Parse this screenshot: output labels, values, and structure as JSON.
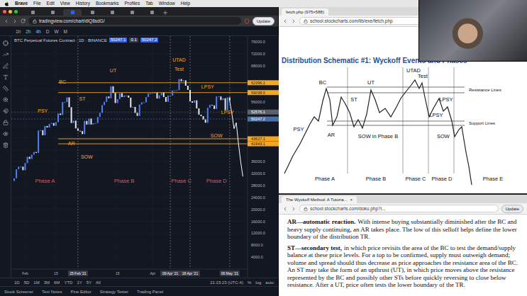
{
  "menubar": {
    "app": "Brave",
    "items": [
      "File",
      "Edit",
      "View",
      "History",
      "Bookmarks",
      "Profiles",
      "Tab",
      "Window",
      "Help"
    ]
  },
  "chart_window": {
    "tabs": [
      {
        "selected": false
      },
      {
        "selected": false
      },
      {
        "selected": true
      },
      {
        "selected": false
      },
      {
        "selected": false
      },
      {
        "selected": false
      },
      {
        "selected": false
      }
    ],
    "url": "tradingview.com/chart/dIQ8sdG/",
    "update": "Update",
    "intervals": [
      "1h",
      "2h",
      "4h",
      "D",
      "W",
      "M"
    ],
    "legend": {
      "title": "BTC Perpetual Futures Contract · 1D · BINANCE",
      "chips": [
        "50247.1",
        "0.1",
        "50247.2"
      ]
    },
    "price_ticks": [
      "76000.0",
      "72000.0",
      "68000.0",
      "64000.0",
      "60000.0",
      "56000.0",
      "52000.0",
      "48000.0",
      "44000.0",
      "40000.0",
      "36000.0",
      "32000.0",
      "28000.0",
      "24000.0",
      "20000.0",
      "16000.0",
      "12000.0",
      "8000.0",
      "4000.0"
    ],
    "date_ticks": [
      {
        "label": "Feb",
        "index": 5,
        "highlighted": false
      },
      {
        "label": "15",
        "index": 19,
        "highlighted": false
      },
      {
        "label": "25 Feb '21",
        "index": 29,
        "highlighted": true
      },
      {
        "label": "15",
        "index": 47,
        "highlighted": false
      },
      {
        "label": "Apr",
        "index": 63,
        "highlighted": false
      },
      {
        "label": "09 Apr '21",
        "index": 71,
        "highlighted": true
      },
      {
        "label": "18 Apr '21",
        "index": 80,
        "highlighted": true
      },
      {
        "label": "06 May '21",
        "index": 98,
        "highlighted": true
      }
    ],
    "series": [
      {
        "name": "BTCUSDT",
        "closes": [
          30400,
          33400,
          34300,
          34300,
          33100,
          35500,
          37600,
          36900,
          38300,
          39200,
          38900,
          46400,
          46500,
          44800,
          47900,
          47400,
          48600,
          48900,
          48000,
          49200,
          52100,
          51600,
          55900,
          55900,
          57500,
          54200,
          48900,
          49700,
          47100,
          46300,
          46200,
          45200,
          49600,
          48400,
          50400,
          48400,
          48800,
          48900,
          50900,
          52300,
          54900,
          56000,
          57800,
          57200,
          61200,
          59000,
          55600,
          56900,
          58900,
          57600,
          58100,
          58100,
          57400,
          54100,
          54300,
          52300,
          51300,
          55100,
          55800,
          55800,
          57600,
          58800,
          58800,
          59000,
          59100,
          57100,
          58200,
          59100,
          57600,
          56000,
          58100,
          58100,
          59800,
          59800,
          59900,
          63600,
          62900,
          63200,
          61400,
          60000,
          56200,
          55700,
          56500,
          53800,
          51700,
          51200,
          50100,
          49000,
          54000,
          55000,
          54800,
          53600,
          57800,
          57800,
          56600,
          57200,
          53200,
          57500,
          56400
        ]
      }
    ],
    "projection": {
      "start_index": 98,
      "values": [
        56400,
        52000,
        47000,
        49000,
        42000,
        36000,
        31000
      ]
    },
    "levels": [
      {
        "label": "62396.1",
        "value": 62396.1,
        "kind": "drawing",
        "color": "#f5a623"
      },
      {
        "label": "59098.0",
        "value": 59098.0,
        "kind": "drawing",
        "color": "#f5a623"
      },
      {
        "label": "52576.1",
        "value": 52576.1,
        "kind": "crosshair",
        "color": "#5d606b"
      },
      {
        "label": "50247.2",
        "value": 50247.2,
        "kind": "last",
        "color": "#4a6fa5"
      },
      {
        "label": "43627.1",
        "value": 43627.1,
        "kind": "drawing",
        "color": "#f5a623"
      },
      {
        "label": "41943.1",
        "value": 41943.1,
        "kind": "drawing",
        "color": "#f5a623"
      }
    ],
    "annotations": [
      {
        "text": "PSY",
        "kind": "event",
        "index": 13,
        "price": 52500
      },
      {
        "text": "BC",
        "kind": "event",
        "index": 22,
        "price": 62000
      },
      {
        "text": "ST",
        "kind": "event",
        "index": 31,
        "price": 56500
      },
      {
        "text": "AR",
        "kind": "event",
        "index": 26,
        "price": 41500
      },
      {
        "text": "SOW",
        "kind": "event",
        "index": 33,
        "price": 37000
      },
      {
        "text": "UT",
        "kind": "event",
        "index": 45,
        "price": 66000
      },
      {
        "text": "UTAD",
        "kind": "event",
        "index": 75,
        "price": 69500
      },
      {
        "text": "Test",
        "kind": "event",
        "index": 75,
        "price": 66500
      },
      {
        "text": "LPSY",
        "kind": "event",
        "index": 88,
        "price": 60500
      },
      {
        "text": "LPSY",
        "kind": "event",
        "index": 97,
        "price": 52000
      },
      {
        "text": "SOW",
        "kind": "event",
        "index": 92,
        "price": 44000
      },
      {
        "text": "Phase A",
        "kind": "phase",
        "index": 14,
        "price": 29000
      },
      {
        "text": "Phase B",
        "kind": "phase",
        "index": 50,
        "price": 29000
      },
      {
        "text": "Phase C",
        "kind": "phase",
        "index": 76,
        "price": 29000
      },
      {
        "text": "Phase D",
        "kind": "phase",
        "index": 92,
        "price": 29000
      }
    ],
    "ranges": [
      "1D",
      "5D",
      "1M",
      "3M",
      "6M",
      "YTD",
      "1Y",
      "5Y",
      "All"
    ],
    "time": "21:15:23 (UTC-4)",
    "scale_options": [
      "%",
      "log",
      "auto"
    ],
    "panels": [
      "Stock Screener",
      "Text Notes",
      "Pine Editor",
      "Strategy Tester",
      "Trading Panel"
    ]
  },
  "schematic_window": {
    "tab": "fetch.php (975×588)",
    "url": "school.stockcharts.com/lib/exe/fetch.php",
    "title": "Distribution Schematic #1: Wyckoff Events and Phases",
    "path": [
      [
        8,
        150
      ],
      [
        20,
        125
      ],
      [
        30,
        108
      ],
      [
        38,
        92
      ],
      [
        44,
        80
      ],
      [
        50,
        70
      ],
      [
        56,
        76
      ],
      [
        62,
        48
      ],
      [
        67,
        30
      ],
      [
        72,
        46
      ],
      [
        76,
        82
      ],
      [
        82,
        70
      ],
      [
        88,
        42
      ],
      [
        94,
        52
      ],
      [
        100,
        64
      ],
      [
        106,
        84
      ],
      [
        112,
        74
      ],
      [
        118,
        86
      ],
      [
        124,
        66
      ],
      [
        130,
        32
      ],
      [
        136,
        46
      ],
      [
        142,
        64
      ],
      [
        150,
        58
      ],
      [
        158,
        70
      ],
      [
        166,
        56
      ],
      [
        172,
        44
      ],
      [
        178,
        36
      ],
      [
        186,
        26
      ],
      [
        192,
        18
      ],
      [
        198,
        30
      ],
      [
        202,
        22
      ],
      [
        206,
        42
      ],
      [
        212,
        70
      ],
      [
        218,
        58
      ],
      [
        226,
        44
      ],
      [
        232,
        62
      ],
      [
        238,
        56
      ],
      [
        244,
        76
      ],
      [
        248,
        98
      ],
      [
        254,
        88
      ],
      [
        258,
        84
      ],
      [
        264,
        120
      ],
      [
        268,
        140
      ],
      [
        272,
        166
      ]
    ],
    "dividers": [
      97,
      175,
      211,
      247
    ],
    "resistance": [
      28,
      36
    ],
    "support": [
      76,
      82
    ],
    "labels": [
      {
        "text": "PSY",
        "kind": "event",
        "x": 28,
        "y": 90
      },
      {
        "text": "BC",
        "kind": "event",
        "x": 62,
        "y": 24
      },
      {
        "text": "ST",
        "kind": "event",
        "x": 106,
        "y": 48
      },
      {
        "text": "AR",
        "kind": "event",
        "x": 74,
        "y": 98
      },
      {
        "text": "SOW in Phase B",
        "kind": "event",
        "x": 140,
        "y": 100
      },
      {
        "text": "UT",
        "kind": "event",
        "x": 130,
        "y": 24
      },
      {
        "text": "UTAD",
        "kind": "event",
        "x": 190,
        "y": 7
      },
      {
        "text": "Test",
        "kind": "event",
        "x": 203,
        "y": 15
      },
      {
        "text": "LPSY",
        "kind": "event",
        "x": 236,
        "y": 48
      },
      {
        "text": "LPSY",
        "kind": "event",
        "x": 222,
        "y": 70
      },
      {
        "text": "SOW",
        "kind": "event",
        "x": 232,
        "y": 100
      },
      {
        "text": "Resistance Lines",
        "kind": "line",
        "x": 268,
        "y": 34
      },
      {
        "text": "Support Lines",
        "kind": "line",
        "x": 268,
        "y": 81
      },
      {
        "text": "Phase A",
        "kind": "phase",
        "x": 65,
        "y": 160
      },
      {
        "text": "Phase B",
        "kind": "phase",
        "x": 137,
        "y": 160
      },
      {
        "text": "Phase C",
        "kind": "phase",
        "x": 193,
        "y": 160
      },
      {
        "text": "Phase D",
        "kind": "phase",
        "x": 230,
        "y": 160
      },
      {
        "text": "Phase E",
        "kind": "phase",
        "x": 302,
        "y": 160
      }
    ]
  },
  "tutorial_window": {
    "tab": "The Wyckoff Method: A Tutoria...",
    "close": "×",
    "url": "school.stockcharts.com/doku.php?i...",
    "update": "Update",
    "paragraphs": [
      {
        "term": "AR—automatic reaction.",
        "body": "With intense buying substantially diminished after the BC and heavy supply continuing, an AR takes place. The low of this selloff helps define the lower boundary of the distribution TR."
      },
      {
        "term": "ST—secondary test,",
        "body": "in which price revisits the area of the BC to test the demand/supply balance at these price levels. For a top to be confirmed, supply must outweigh demand; volume and spread should thus decrease as price approaches the resistance area of the BC. An ST may take the form of an upthrust (UT), in which price moves above the resistance represented by the BC and possibly other STs before quickly reversing to close below resistance. After a UT, price often tests the lower boundary of the TR."
      }
    ]
  }
}
